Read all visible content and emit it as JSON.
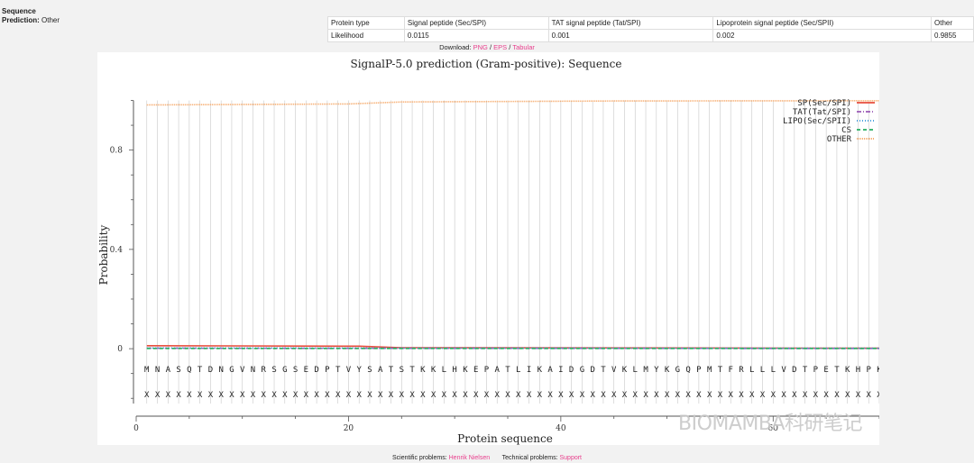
{
  "summary": {
    "sequence_label": "Sequence",
    "prediction_key": "Prediction:",
    "prediction_value": "Other"
  },
  "table": {
    "headers": [
      "Protein type",
      "Signal peptide (Sec/SPI)",
      "TAT signal peptide (Tat/SPI)",
      "Lipoprotein signal peptide (Sec/SPII)",
      "Other"
    ],
    "rows": [
      [
        "Likelihood",
        "0.0115",
        "0.001",
        "0.002",
        "0.9855"
      ]
    ]
  },
  "download": {
    "label": "Download:",
    "png": "PNG",
    "sep1": "/",
    "eps": "EPS",
    "sep2": "/",
    "tabular": "Tabular"
  },
  "footer": {
    "sci_label": "Scientific problems:",
    "sci_contact": "Henrik Nielsen",
    "tech_label": "Technical problems:",
    "tech_contact": "Support"
  },
  "watermark": "BIOMAMBA科研笔记",
  "chart_data": {
    "type": "line",
    "title": "SignalP-5.0 prediction (Gram-positive):  Sequence",
    "xlabel": "Protein sequence",
    "ylabel": "Probability",
    "xlim": [
      0,
      70
    ],
    "ylim": [
      -0.25,
      1.02
    ],
    "x_ticks": [
      0,
      20,
      40,
      60
    ],
    "y_ticks": [
      0,
      0.4,
      0.8
    ],
    "y_tick_labels": [
      "0",
      "0.4",
      "0.8"
    ],
    "sequence": [
      "M",
      "N",
      "A",
      "S",
      "Q",
      "T",
      "D",
      "N",
      "G",
      "V",
      "N",
      "R",
      "S",
      "G",
      "S",
      "E",
      "D",
      "P",
      "T",
      "V",
      "Y",
      "S",
      "A",
      "T",
      "S",
      "T",
      "K",
      "K",
      "L",
      "H",
      "K",
      "E",
      "P",
      "A",
      "T",
      "L",
      "I",
      "K",
      "A",
      "I",
      "D",
      "G",
      "D",
      "T",
      "V",
      "K",
      "L",
      "M",
      "Y",
      "K",
      "G",
      "Q",
      "P",
      "M",
      "T",
      "F",
      "R",
      "L",
      "L",
      "L",
      "V",
      "D",
      "T",
      "P",
      "E",
      "T",
      "K",
      "H",
      "P",
      "K"
    ],
    "annotation_char": "X",
    "series": [
      {
        "name": "SP(Sec/SPI)",
        "color": "#e74c3c",
        "dash": "",
        "points": [
          [
            1,
            0.012
          ],
          [
            21,
            0.01
          ],
          [
            25,
            0.004
          ],
          [
            70,
            0.002
          ]
        ]
      },
      {
        "name": "TAT(Tat/SPI)",
        "color": "#9b59b6",
        "dash": "5,2,1,2",
        "points": [
          [
            1,
            0.002
          ],
          [
            70,
            0.001
          ]
        ]
      },
      {
        "name": "LIPO(Sec/SPII)",
        "color": "#3498db",
        "dash": "1,2",
        "points": [
          [
            1,
            0.003
          ],
          [
            70,
            0.002
          ]
        ]
      },
      {
        "name": "CS",
        "color": "#27ae60",
        "dash": "4,3",
        "points": [
          [
            1,
            0.001
          ],
          [
            70,
            0.001
          ]
        ]
      },
      {
        "name": "OTHER",
        "color": "#f5a05a",
        "dash": "1,1",
        "points": [
          [
            1,
            0.982
          ],
          [
            20,
            0.986
          ],
          [
            25,
            0.994
          ],
          [
            45,
            0.998
          ],
          [
            70,
            0.999
          ]
        ]
      }
    ],
    "legend_position": "top-right"
  }
}
